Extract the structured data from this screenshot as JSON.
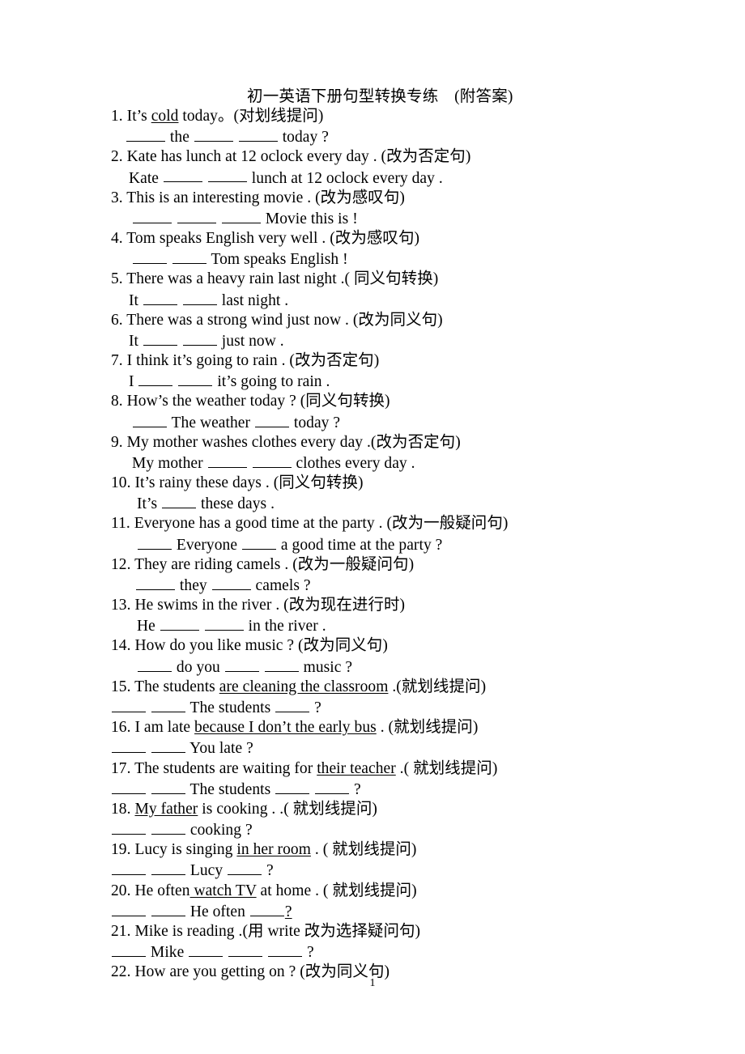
{
  "document": {
    "title": "初一英语下册句型转换专练　(附答案)",
    "page_number": "1",
    "lines": [
      {
        "id": "q1",
        "type": "question",
        "indent": 0,
        "number": "1.",
        "text": "It’s cold today。(对划线提问)",
        "underlined": "cold"
      },
      {
        "id": "a1",
        "type": "answer",
        "indent": 18,
        "text": "______ the ______ ______ today ?"
      },
      {
        "id": "q2",
        "type": "question",
        "indent": 0,
        "number": "2.",
        "text": "Kate has lunch at 12 oclock every day . (改为否定句)"
      },
      {
        "id": "a2",
        "type": "answer",
        "indent": 22,
        "text": "Kate ______ ______ lunch at 12 oclock every day ."
      },
      {
        "id": "q3",
        "type": "question",
        "indent": 0,
        "number": "3.",
        "text": "This is an interesting movie . (改为感叹句)"
      },
      {
        "id": "a3",
        "type": "answer",
        "indent": 26,
        "text": "______ ______ ______ Movie this is !"
      },
      {
        "id": "q4",
        "type": "question",
        "indent": 0,
        "number": "4.",
        "text": "Tom speaks English very well . (改为感叹句)"
      },
      {
        "id": "a4",
        "type": "answer",
        "indent": 26,
        "text": "_____ _____ Tom speaks English !"
      },
      {
        "id": "q5",
        "type": "question",
        "indent": 0,
        "number": "5.",
        "text": "There was a heavy rain last night .( 同义句转换)"
      },
      {
        "id": "a5",
        "type": "answer",
        "indent": 22,
        "text": "It _____ _____ last night ."
      },
      {
        "id": "q6",
        "type": "question",
        "indent": 0,
        "number": "6.",
        "text": "There was a strong wind just now . (改为同义句)"
      },
      {
        "id": "a6",
        "type": "answer",
        "indent": 22,
        "text": "It _____ _____ just now ."
      },
      {
        "id": "q7",
        "type": "question",
        "indent": 0,
        "number": "7.",
        "text": "I think it’s going to rain . (改为否定句)"
      },
      {
        "id": "a7",
        "type": "answer",
        "indent": 22,
        "text": "I _____ _____ it’s going to rain ."
      },
      {
        "id": "q8",
        "type": "question",
        "indent": 0,
        "number": "8.",
        "text": "How’s the weather today ? (同义句转换)"
      },
      {
        "id": "a8",
        "type": "answer",
        "indent": 26,
        "text": "_____ The weather _____ today ?"
      },
      {
        "id": "q9",
        "type": "question",
        "indent": 0,
        "number": "9.",
        "text": "My mother washes clothes every day .(改为否定句)"
      },
      {
        "id": "a9",
        "type": "answer",
        "indent": 26,
        "text": "My mother _____ _____ clothes every day ."
      },
      {
        "id": "q10",
        "type": "question",
        "indent": 0,
        "number": "10.",
        "text": "It’s rainy these days . (同义句转换)"
      },
      {
        "id": "a10",
        "type": "answer",
        "indent": 30,
        "text": "It’s _____ these days ."
      },
      {
        "id": "q11",
        "type": "question",
        "indent": 0,
        "number": "11.",
        "text": "Everyone has a good time at the party . (改为一般疑问句)"
      },
      {
        "id": "a11",
        "type": "answer",
        "indent": 30,
        "text": "_____ Everyone _____ a good time at the party ?"
      },
      {
        "id": "q12",
        "type": "question",
        "indent": 0,
        "number": "12.",
        "text": "They are riding camels . (改为一般疑问句)"
      },
      {
        "id": "a12",
        "type": "answer",
        "indent": 30,
        "text": "_____ they _____ camels ?"
      },
      {
        "id": "q13",
        "type": "question",
        "indent": 0,
        "number": "13.",
        "text": "He swims in the river . (改为现在进行时)"
      },
      {
        "id": "a13",
        "type": "answer",
        "indent": 30,
        "text": "He _____ _____ in the river ."
      },
      {
        "id": "q14",
        "type": "question",
        "indent": 0,
        "number": "14.",
        "text": "How do you like music ? (改为同义句)"
      },
      {
        "id": "a14",
        "type": "answer",
        "indent": 30,
        "text": "_____ do you _____ _____ music ?"
      },
      {
        "id": "q15",
        "type": "question",
        "indent": 0,
        "number": "15.",
        "text": "The students are cleaning the classroom .(就划线提问)",
        "underlined": "are cleaning the classroom"
      },
      {
        "id": "a15",
        "type": "answer",
        "indent": 0,
        "text": "_____ _____ The students _____ ?"
      },
      {
        "id": "q16",
        "type": "question",
        "indent": 0,
        "number": "16.",
        "text": "I am late because I don’t the early bus . (就划线提问)",
        "underlined": "because I don’t the early bus"
      },
      {
        "id": "a16",
        "type": "answer",
        "indent": 0,
        "text": "_____ _____ You late ?"
      },
      {
        "id": "q17",
        "type": "question",
        "indent": 0,
        "number": "17.",
        "text": "The students are waiting for their teacher .( 就划线提问)",
        "underlined": "their teacher"
      },
      {
        "id": "a17",
        "type": "answer",
        "indent": 0,
        "text": "_____ _____ The students _____ _____ ?"
      },
      {
        "id": "q18",
        "type": "question",
        "indent": 0,
        "number": "18.",
        "text": "My father is cooking . .( 就划线提问)",
        "underlined": "My father"
      },
      {
        "id": "a18",
        "type": "answer",
        "indent": 0,
        "text": "_____ _____ cooking ?"
      },
      {
        "id": "q19",
        "type": "question",
        "indent": 0,
        "number": "19.",
        "text": "Lucy is singing in her room . ( 就划线提问)",
        "underlined": "in her room"
      },
      {
        "id": "a19",
        "type": "answer",
        "indent": 0,
        "text": "_____ _____ Lucy _____ ?"
      },
      {
        "id": "q20",
        "type": "question",
        "indent": 0,
        "number": "20.",
        "text": "He often watch TV at home . ( 就划线提问)",
        "underlined": " watch TV"
      },
      {
        "id": "a20",
        "type": "answer",
        "indent": 0,
        "text": "_____ _____ He often ______?"
      },
      {
        "id": "q21",
        "type": "question",
        "indent": 0,
        "number": "21.",
        "text": "Mike is reading .(用 write 改为选择疑问句)"
      },
      {
        "id": "a21",
        "type": "answer",
        "indent": 0,
        "text": "_____ Mike _____ _____ _____ ?"
      },
      {
        "id": "q22",
        "type": "question",
        "indent": 0,
        "number": "22.",
        "text": "How are you getting on ? (改为同义句)"
      }
    ]
  }
}
